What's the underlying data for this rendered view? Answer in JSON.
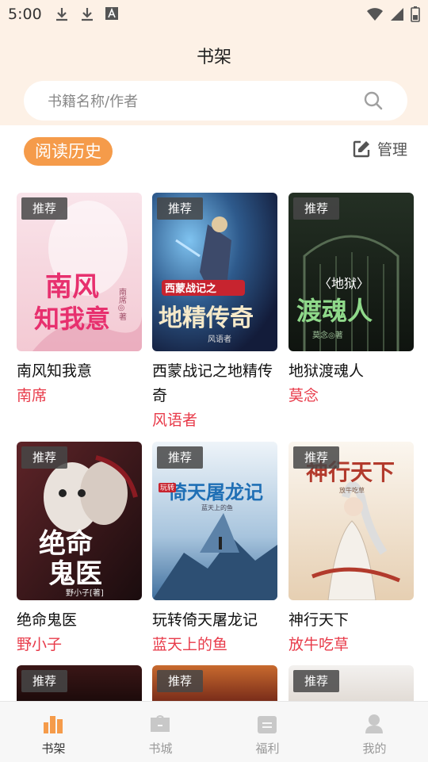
{
  "status_bar": {
    "time": "5:00"
  },
  "header": {
    "title": "书架"
  },
  "search": {
    "placeholder": "书籍名称/作者"
  },
  "history_label": "阅读历史",
  "manage_label": "管理",
  "badge_label": "推荐",
  "books": [
    {
      "title": "南风知我意",
      "author": "南席"
    },
    {
      "title": "西蒙战记之地精传奇",
      "author": "风语者"
    },
    {
      "title": "地狱渡魂人",
      "author": "莫念"
    },
    {
      "title": "绝命鬼医",
      "author": "野小子"
    },
    {
      "title": "玩转倚天屠龙记",
      "author": "蓝天上的鱼"
    },
    {
      "title": "神行天下",
      "author": "放牛吃草"
    }
  ],
  "covers": [
    {
      "line1": "南风",
      "line2": "知我意",
      "side": "南席◎著",
      "colors": [
        "#f9e4ea",
        "#f5c8d4",
        "#e98aa4"
      ]
    },
    {
      "line1": "西蒙战记之",
      "line2": "地精传奇",
      "side": "风语者",
      "colors": [
        "#1c2a52",
        "#2e5a8c",
        "#c9a45a"
      ]
    },
    {
      "line1": "〈地狱〉",
      "line2": "渡魂人",
      "side": "莫念◎著",
      "colors": [
        "#1a2219",
        "#3a5236",
        "#7ba06f"
      ]
    },
    {
      "line1": "绝命",
      "line2": "鬼医",
      "side": "野小子[著]",
      "colors": [
        "#2a1416",
        "#5e2428",
        "#b02a33"
      ]
    },
    {
      "line1": "玩转",
      "line2": "倚天屠龙记",
      "side": "蓝天上的鱼",
      "colors": [
        "#d9e6f1",
        "#86aed0",
        "#3f6f9e"
      ]
    },
    {
      "line1": "神行天下",
      "line2": "",
      "side": "放牛吃草",
      "colors": [
        "#f5efe6",
        "#e5cdb0",
        "#b23a2c"
      ]
    }
  ],
  "tabs": [
    {
      "label": "书架",
      "icon": "bookshelf-icon",
      "active": true
    },
    {
      "label": "书城",
      "icon": "bookstore-icon",
      "active": false
    },
    {
      "label": "福利",
      "icon": "welfare-icon",
      "active": false
    },
    {
      "label": "我的",
      "icon": "profile-icon",
      "active": false
    }
  ],
  "colors": {
    "accent": "#f59b4a",
    "author": "#e83b4a",
    "header_bg": "#fdf1e6"
  }
}
